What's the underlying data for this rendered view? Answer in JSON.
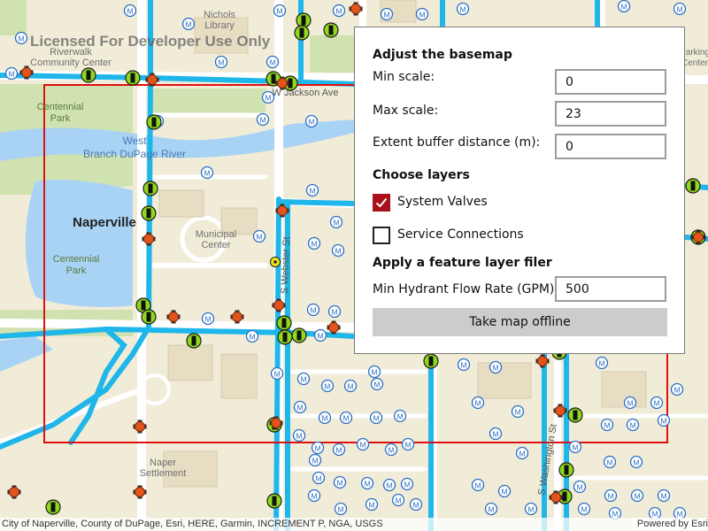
{
  "map": {
    "watermark": "Licensed For Developer Use Only",
    "labels": {
      "nichols_library": "Nichols\nLibrary",
      "riverwalk_center": "Riverwalk\nCommunity Center",
      "centennial_park_top": "Centennial\nPark",
      "branch_river": "West\nBranch DuPage River",
      "naperville": "Naperville",
      "municipal_center": "Municipal\nCenter",
      "centennial_park_bottom": "Centennial\nPark",
      "naper_settlement": "Naper\nSettlement",
      "jackson_ave": "W Jackson Ave",
      "webster_st": "S Webster St",
      "washington_st": "S Washington St",
      "parking": "Parking\nCenter"
    },
    "attribution_left": "City of Naperville, County of DuPage, Esri, HERE, Garmin, INCREMENT P, NGA, USGS",
    "attribution_right": "Powered by Esri",
    "colors": {
      "background": "#f1ecd8",
      "water": "#a9d3f5",
      "park": "#d1e2b1",
      "road": "#ffffff",
      "pipe": "#1fb6ea",
      "extent": "#e01010",
      "valve_fill": "#8fd81c",
      "hydrant": "#e2541c",
      "meter": "#2a6fc4"
    }
  },
  "panel": {
    "section_basemap": "Adjust the basemap",
    "min_scale_label": "Min scale:",
    "min_scale_value": "0",
    "max_scale_label": "Max scale:",
    "max_scale_value": "23",
    "buffer_label": "Extent buffer distance (m):",
    "buffer_value": "0",
    "section_layers": "Choose layers",
    "layer_valves_label": "System Valves",
    "layer_valves_checked": true,
    "layer_connections_label": "Service Connections",
    "layer_connections_checked": false,
    "section_filter": "Apply a feature layer filer",
    "flow_rate_label": "Min Hydrant Flow Rate (GPM):",
    "flow_rate_value": "500",
    "offline_button": "Take map offline"
  }
}
